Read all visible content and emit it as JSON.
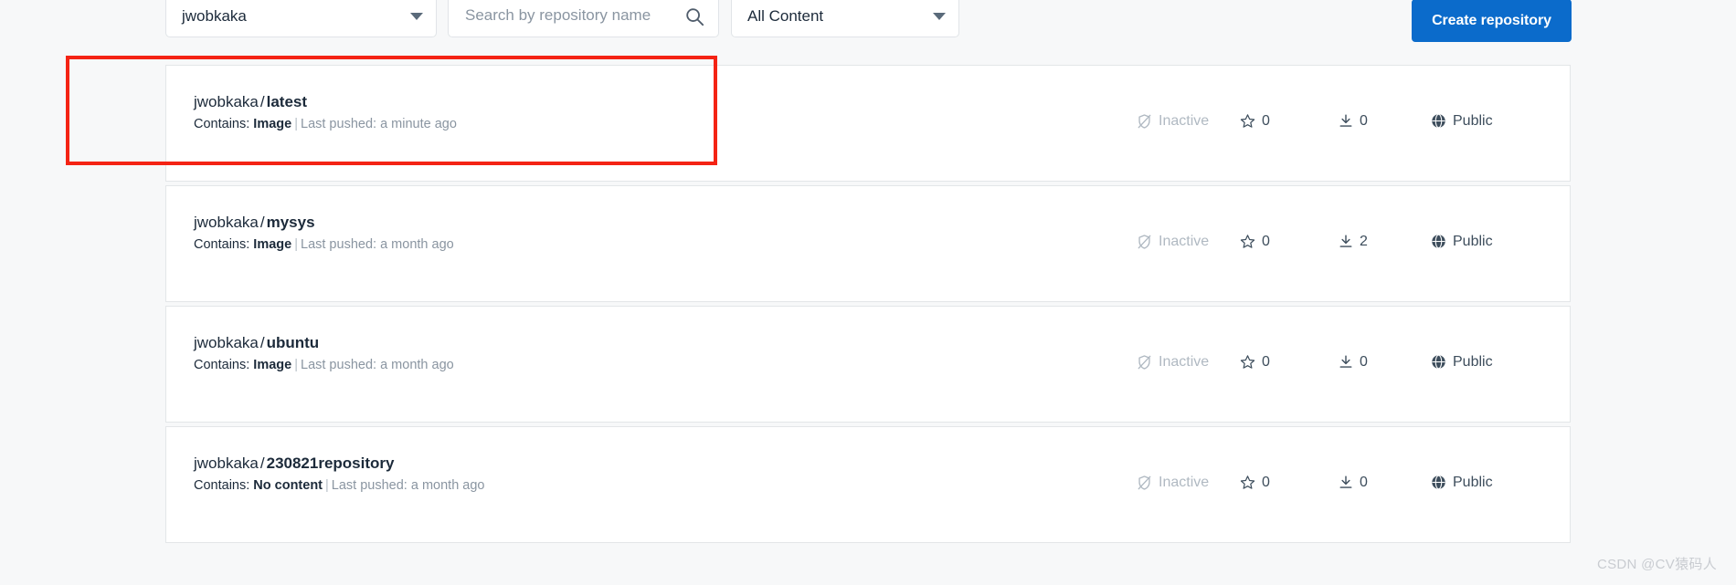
{
  "toolbar": {
    "namespace_select": {
      "value": "jwobkaka",
      "icon": "chevron-down-icon"
    },
    "search": {
      "value": "",
      "placeholder": "Search by repository name",
      "icon": "search-icon"
    },
    "content_select": {
      "value": "All Content",
      "icon": "chevron-down-icon"
    },
    "create_button": {
      "label": "Create repository"
    }
  },
  "labels": {
    "contains_prefix": "Contains:",
    "pushed_prefix": "Last pushed:",
    "separator": "|"
  },
  "repositories": [
    {
      "namespace": "jwobkaka",
      "slash": "/",
      "name": "latest",
      "contains": "Image",
      "last_pushed": "a minute ago",
      "status": "Inactive",
      "stars": "0",
      "pulls": "0",
      "visibility": "Public",
      "highlighted": true
    },
    {
      "namespace": "jwobkaka",
      "slash": "/",
      "name": "mysys",
      "contains": "Image",
      "last_pushed": "a month ago",
      "status": "Inactive",
      "stars": "0",
      "pulls": "2",
      "visibility": "Public",
      "highlighted": false
    },
    {
      "namespace": "jwobkaka",
      "slash": "/",
      "name": "ubuntu",
      "contains": "Image",
      "last_pushed": "a month ago",
      "status": "Inactive",
      "stars": "0",
      "pulls": "0",
      "visibility": "Public",
      "highlighted": false
    },
    {
      "namespace": "jwobkaka",
      "slash": "/",
      "name": "230821repository",
      "contains": "No content",
      "last_pushed": "a month ago",
      "status": "Inactive",
      "stars": "0",
      "pulls": "0",
      "visibility": "Public",
      "highlighted": false
    }
  ],
  "watermark": {
    "text": "CSDN @CV猿码人"
  },
  "colors": {
    "accent": "#0b6bcb",
    "highlight": "#f42314",
    "page_bg": "#f7f8f9",
    "card_bg": "#ffffff",
    "muted_text": "#8a95a1"
  }
}
